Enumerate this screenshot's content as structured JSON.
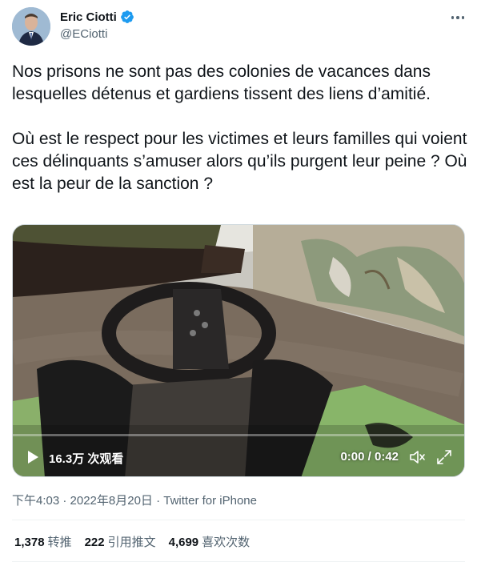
{
  "author": {
    "name": "Eric Ciotti",
    "handle": "@ECiotti"
  },
  "tweet": {
    "text": "Nos prisons ne sont pas des colonies de vacances dans lesquelles détenus et gardiens tissent des liens d’amitié.\n\nOù est le respect pour les victimes et leurs familles qui voient ces délinquants s’amuser alors qu’ils purgent leur peine ? Où est la peur de la sanction ?"
  },
  "video": {
    "views": "16.3万 次观看",
    "time": "0:00 / 0:42",
    "progress": 0
  },
  "meta": {
    "time": "下午4:03 · 2022年8月20日 · ",
    "source": "Twitter for iPhone"
  },
  "stats": {
    "retweets": {
      "count": "1,378",
      "label": "转推"
    },
    "quotes": {
      "count": "222",
      "label": "引用推文"
    },
    "likes": {
      "count": "4,699",
      "label": "喜欢次数"
    }
  },
  "colors": {
    "verified": "#1d9bf0",
    "secondary_text": "#536471",
    "primary_text": "#0f1419"
  }
}
